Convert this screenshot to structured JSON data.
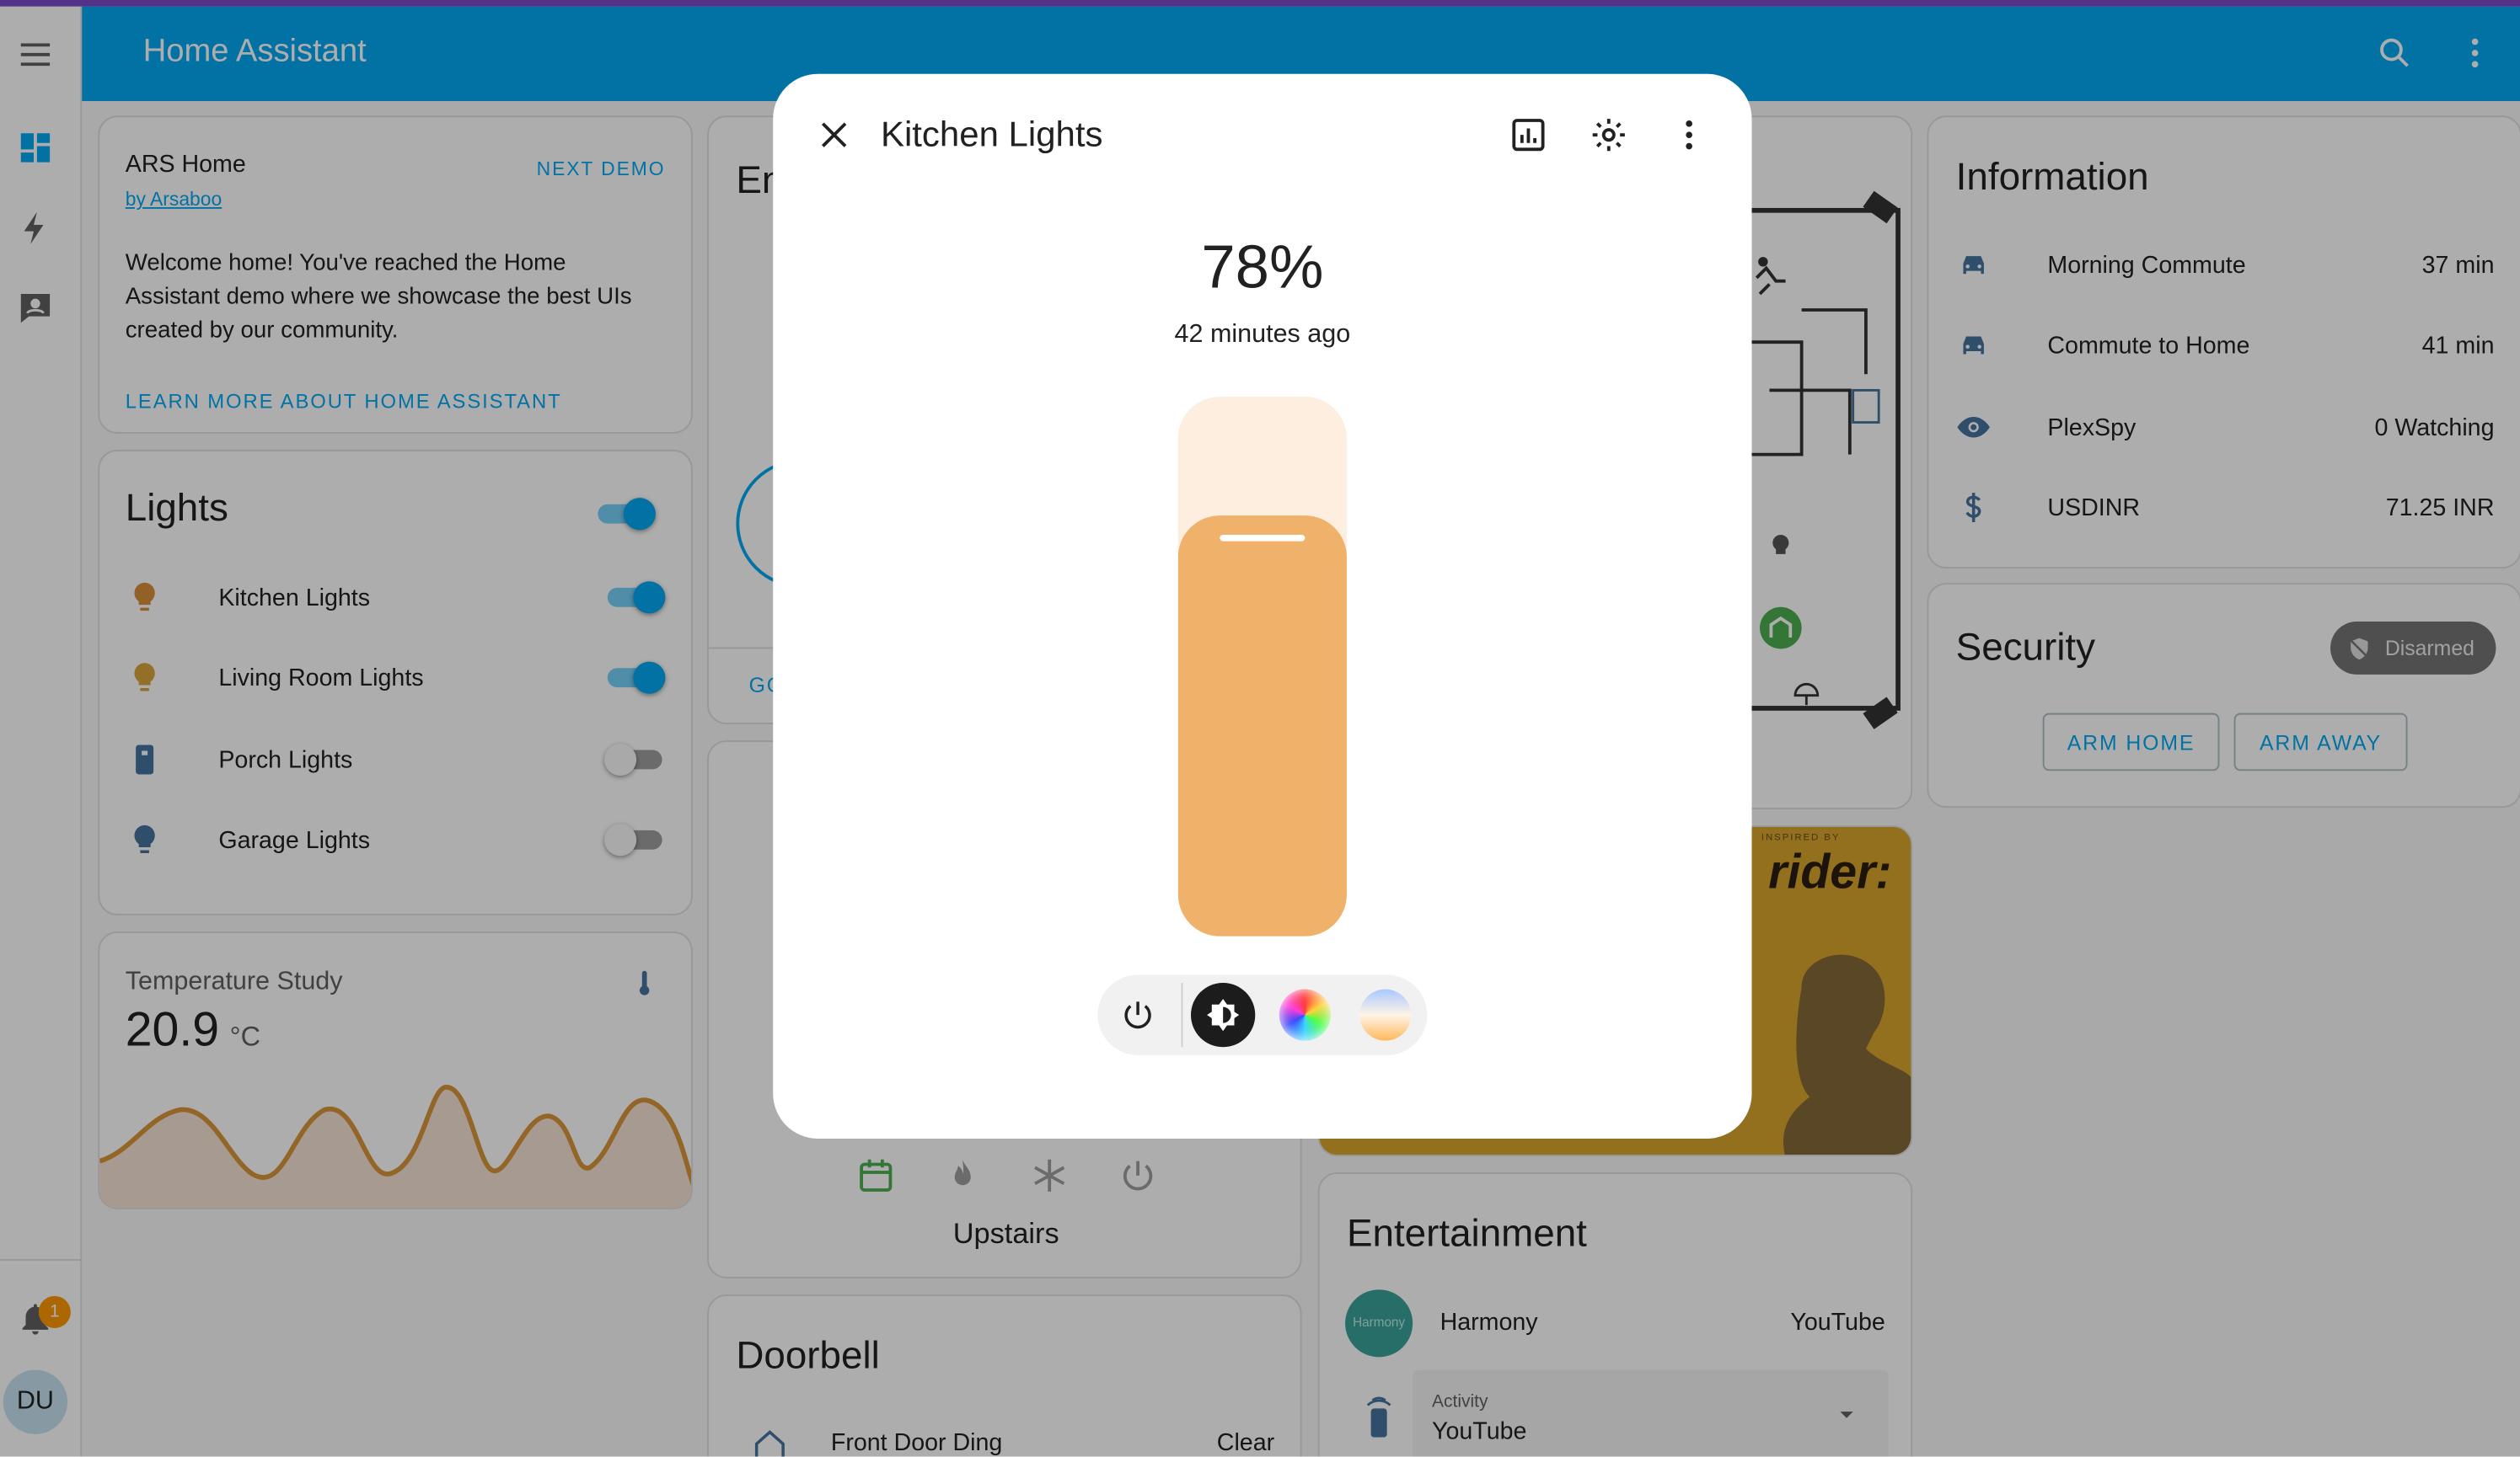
{
  "app": {
    "title": "Home Assistant"
  },
  "sidebar": {
    "notification_count": "1",
    "user_initials": "DU"
  },
  "ars": {
    "title": "ARS Home",
    "author": "by Arsaboo",
    "next_demo": "NEXT DEMO",
    "welcome": "Welcome home! You've reached the Home Assistant demo where we showcase the best UIs created by our community.",
    "learn_more": "LEARN MORE ABOUT HOME ASSISTANT"
  },
  "lights": {
    "title": "Lights",
    "items": [
      {
        "label": "Kitchen Lights",
        "state": "on",
        "color": "#d98f3a"
      },
      {
        "label": "Living Room Lights",
        "state": "on",
        "color": "#d9a43a"
      },
      {
        "label": "Porch Lights",
        "state": "off",
        "color": "#44739e"
      },
      {
        "label": "Garage Lights",
        "state": "off",
        "color": "#44739e"
      }
    ]
  },
  "temperature": {
    "title": "Temperature Study",
    "value": "20.9",
    "unit": "°C"
  },
  "partial_card": {
    "title": "En",
    "button": "GO"
  },
  "thermostat": {
    "name": "Upstairs"
  },
  "doorbell": {
    "title": "Doorbell",
    "row_label": "Front Door Ding",
    "row_value": "Clear"
  },
  "media": {
    "art_text": "rider:",
    "art_caption": "INSPIRED BY"
  },
  "entertainment": {
    "title": "Entertainment",
    "harmony_label": "Harmony",
    "harmony_logo": "Harmony",
    "harmony_value": "YouTube",
    "activity_label": "Activity",
    "activity_value": "YouTube"
  },
  "information": {
    "title": "Information",
    "rows": [
      {
        "icon": "car-icon",
        "label": "Morning Commute",
        "value": "37 min"
      },
      {
        "icon": "car-icon",
        "label": "Commute to Home",
        "value": "41 min"
      },
      {
        "icon": "eye-icon",
        "label": "PlexSpy",
        "value": "0 Watching"
      },
      {
        "icon": "dollar-icon",
        "label": "USDINR",
        "value": "71.25 INR"
      }
    ]
  },
  "security": {
    "title": "Security",
    "state": "Disarmed",
    "arm_home": "ARM HOME",
    "arm_away": "ARM AWAY"
  },
  "dialog": {
    "title": "Kitchen Lights",
    "value": "78%",
    "last_changed": "42 minutes ago",
    "brightness": 0.78,
    "accent": "#f0b26a"
  }
}
